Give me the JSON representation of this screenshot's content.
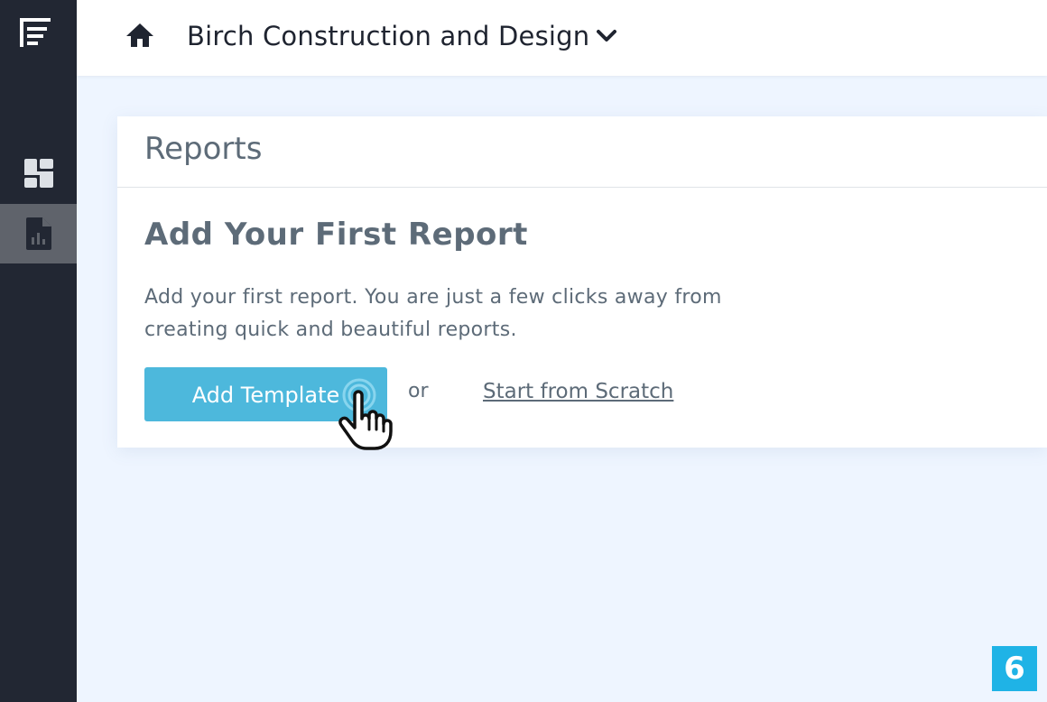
{
  "header": {
    "org_name": "Birch Construction and Design"
  },
  "sidebar": {
    "items": [
      {
        "id": "dashboard",
        "icon": "dashboard-grid-icon",
        "active": false
      },
      {
        "id": "reports",
        "icon": "report-chart-icon",
        "active": true
      }
    ]
  },
  "card": {
    "title": "Reports",
    "headline": "Add Your First Report",
    "description": "Add your first report. You are just a few clicks away from creating quick and beautiful reports.",
    "add_template_label": "Add Template",
    "or_text": "or",
    "scratch_link_label": "Start from Scratch"
  },
  "step_badge": "6",
  "colors": {
    "sidebar_bg": "#222733",
    "sidebar_active": "#5f636b",
    "button_bg": "#4db8dc",
    "badge_bg": "#1fb3e6",
    "text": "#5d6b78",
    "page_bg": "#eef5ff"
  }
}
